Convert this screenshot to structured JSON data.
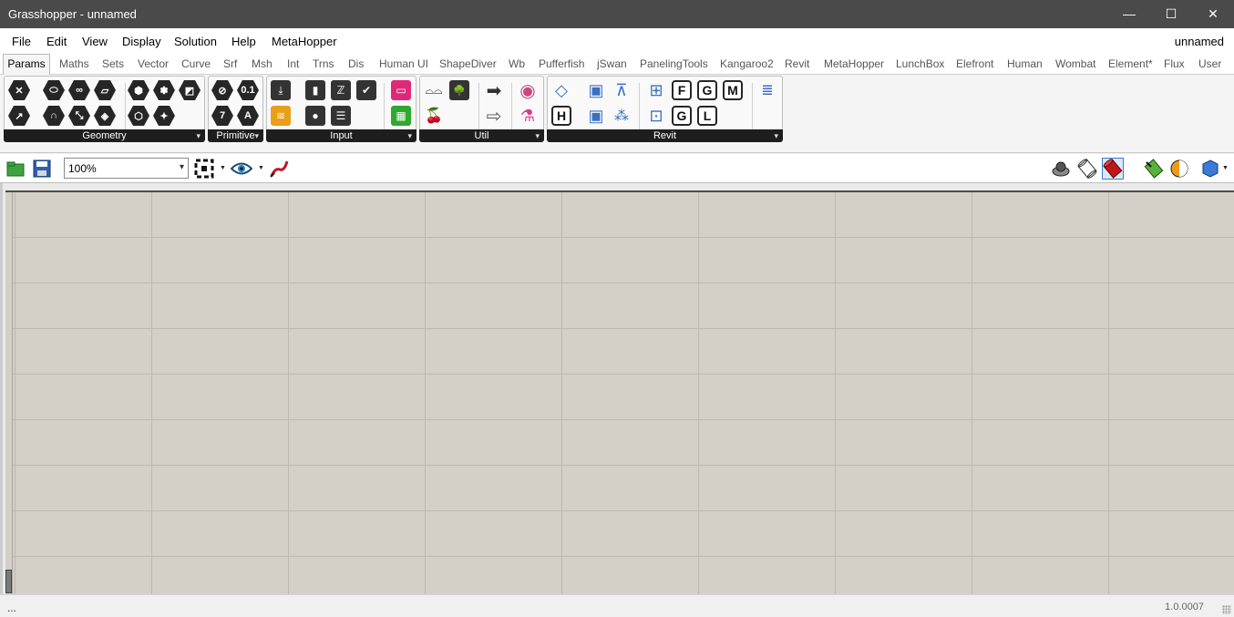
{
  "window": {
    "title": "Grasshopper - unnamed",
    "min_glyph": "—",
    "max_glyph": "☐",
    "close_glyph": "✕"
  },
  "menu": {
    "items": [
      "File",
      "Edit",
      "View",
      "Display",
      "Solution",
      "Help",
      "MetaHopper"
    ],
    "doc_name": "unnamed"
  },
  "tabs": [
    "Params",
    "Maths",
    "Sets",
    "Vector",
    "Curve",
    "Srf",
    "Msh",
    "Int",
    "Trns",
    "Dis",
    "Human UI",
    "ShapeDiver",
    "Wb",
    "Pufferfish",
    "jSwan",
    "PanelingTools",
    "Kangaroo2",
    "Revit",
    "MetaHopper",
    "LunchBox",
    "Elefront",
    "Human",
    "Wombat",
    "Element*",
    "Flux",
    "User"
  ],
  "active_tab": "Params",
  "ribbon": {
    "panels": [
      "Geometry",
      "Primitive",
      "Input",
      "Util",
      "Revit"
    ],
    "expand_glyph": "▾",
    "geometry_icons": {
      "row1": [
        "✕",
        "⬭",
        "∞",
        "▱",
        "⬢",
        "❃",
        "◩"
      ],
      "row2": [
        "↗",
        "∩",
        "⤡",
        "◈",
        "⬡",
        "✦"
      ]
    },
    "primitive_icons": {
      "row1": [
        "⊘",
        "0.1"
      ],
      "row2": [
        "7",
        "A"
      ]
    },
    "input_icons": {
      "row1": [
        "⤓",
        "▮",
        "ℤ",
        "✔",
        "▭"
      ],
      "row2": [
        "≋",
        "●",
        "☰",
        "▦"
      ]
    },
    "util_icons": {
      "row1": [
        "⌓⌓",
        "🌳",
        "➡",
        "◉"
      ],
      "row2": [
        "🍒",
        "⇨",
        "⚗"
      ]
    },
    "revit_icons": {
      "row1": [
        "◇",
        "▣",
        "⊼",
        "⊞",
        "F",
        "G",
        "M",
        "≣"
      ],
      "row2": [
        "H",
        "▣",
        "⁂",
        "⊡",
        "G",
        "L"
      ]
    }
  },
  "toolbar": {
    "zoom_value": "100%",
    "dropdown_glyph": "▾",
    "small_arrow": "▼",
    "open_glyph": "▭",
    "save_glyph": "▣",
    "sketch_glyph": "⌇"
  },
  "status": {
    "left": "...",
    "version": "1.0.0007"
  },
  "colors": {
    "titlebar": "#4a4a4a",
    "canvas": "#d4d0c8",
    "grid": "#bdb9b1",
    "panel_label": "#1e1e1e"
  }
}
